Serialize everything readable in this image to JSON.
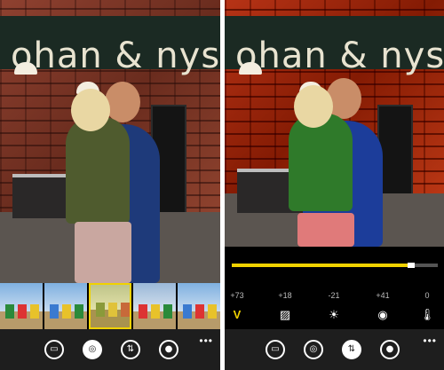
{
  "sign_text": "ohan & nystrom",
  "left": {
    "filters": [
      {
        "id": "filter-1"
      },
      {
        "id": "filter-2"
      },
      {
        "id": "filter-3",
        "selected": true
      },
      {
        "id": "filter-4"
      },
      {
        "id": "filter-5"
      }
    ],
    "appbar": [
      {
        "icon": "crop-rotate-icon",
        "glyph": "▭"
      },
      {
        "icon": "filters-icon",
        "glyph": "◎",
        "active": true
      },
      {
        "icon": "adjust-icon",
        "glyph": "⇅"
      },
      {
        "icon": "color-drop-icon",
        "glyph": "●"
      }
    ],
    "more": "•••"
  },
  "right": {
    "slider_level": 0.87,
    "adjustments": [
      {
        "value": "+73",
        "icon": "vibrance-icon",
        "glyph": "V",
        "active": true
      },
      {
        "value": "+18",
        "icon": "clarity-icon",
        "glyph": "▨"
      },
      {
        "value": "-21",
        "icon": "brightness-icon",
        "glyph": "☀"
      },
      {
        "value": "+41",
        "icon": "saturation-icon",
        "glyph": "◉"
      },
      {
        "value": "0",
        "icon": "temperature-icon",
        "glyph": "🌡"
      }
    ],
    "appbar": [
      {
        "icon": "crop-rotate-icon",
        "glyph": "▭"
      },
      {
        "icon": "filters-icon",
        "glyph": "◎"
      },
      {
        "icon": "adjust-icon",
        "glyph": "⇅",
        "active": true
      },
      {
        "icon": "color-drop-icon",
        "glyph": "●"
      }
    ],
    "more": "•••"
  },
  "colors": {
    "accent": "#f0d200",
    "appbar": "#1e1e1e",
    "divider": "#ffffff"
  }
}
